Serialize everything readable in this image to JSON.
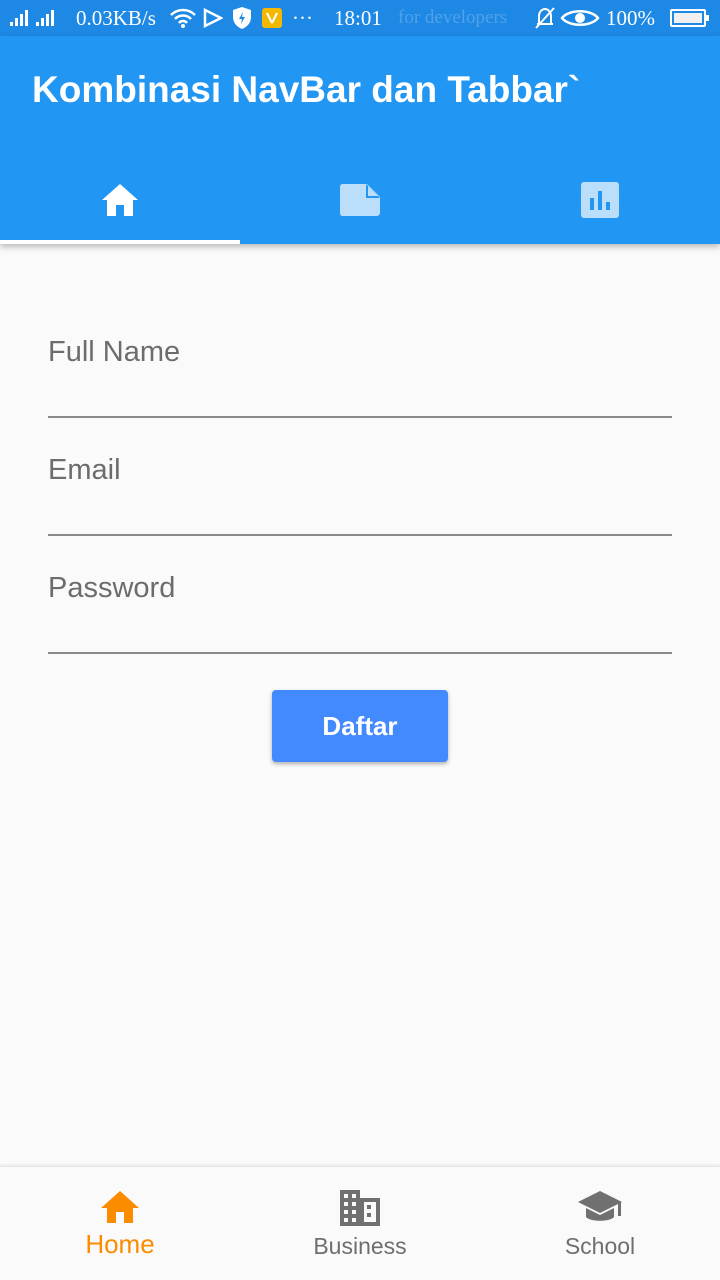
{
  "status_bar": {
    "network_speed": "0.03KB/s",
    "time": "18:01",
    "overflow": "···",
    "background_notice": "for developers",
    "battery": "100%"
  },
  "app_bar": {
    "title": "Kombinasi NavBar dan Tabbar`",
    "tabs": [
      {
        "icon": "home-icon",
        "selected": true
      },
      {
        "icon": "note-icon",
        "selected": false
      },
      {
        "icon": "bar-chart-icon",
        "selected": false
      }
    ]
  },
  "form": {
    "full_name": {
      "placeholder": "Full Name",
      "value": ""
    },
    "email": {
      "placeholder": "Email",
      "value": ""
    },
    "password": {
      "placeholder": "Password",
      "value": ""
    },
    "submit_label": "Daftar"
  },
  "bottom_nav": {
    "items": [
      {
        "label": "Home",
        "icon": "home-icon",
        "active": true
      },
      {
        "label": "Business",
        "icon": "business-icon",
        "active": false
      },
      {
        "label": "School",
        "icon": "school-icon",
        "active": false
      }
    ]
  },
  "colors": {
    "primary": "#2196f3",
    "status_bar": "#1e88e5",
    "button": "#448aff",
    "active_nav": "#fb8c00",
    "inactive_nav": "#6e6e6e"
  }
}
